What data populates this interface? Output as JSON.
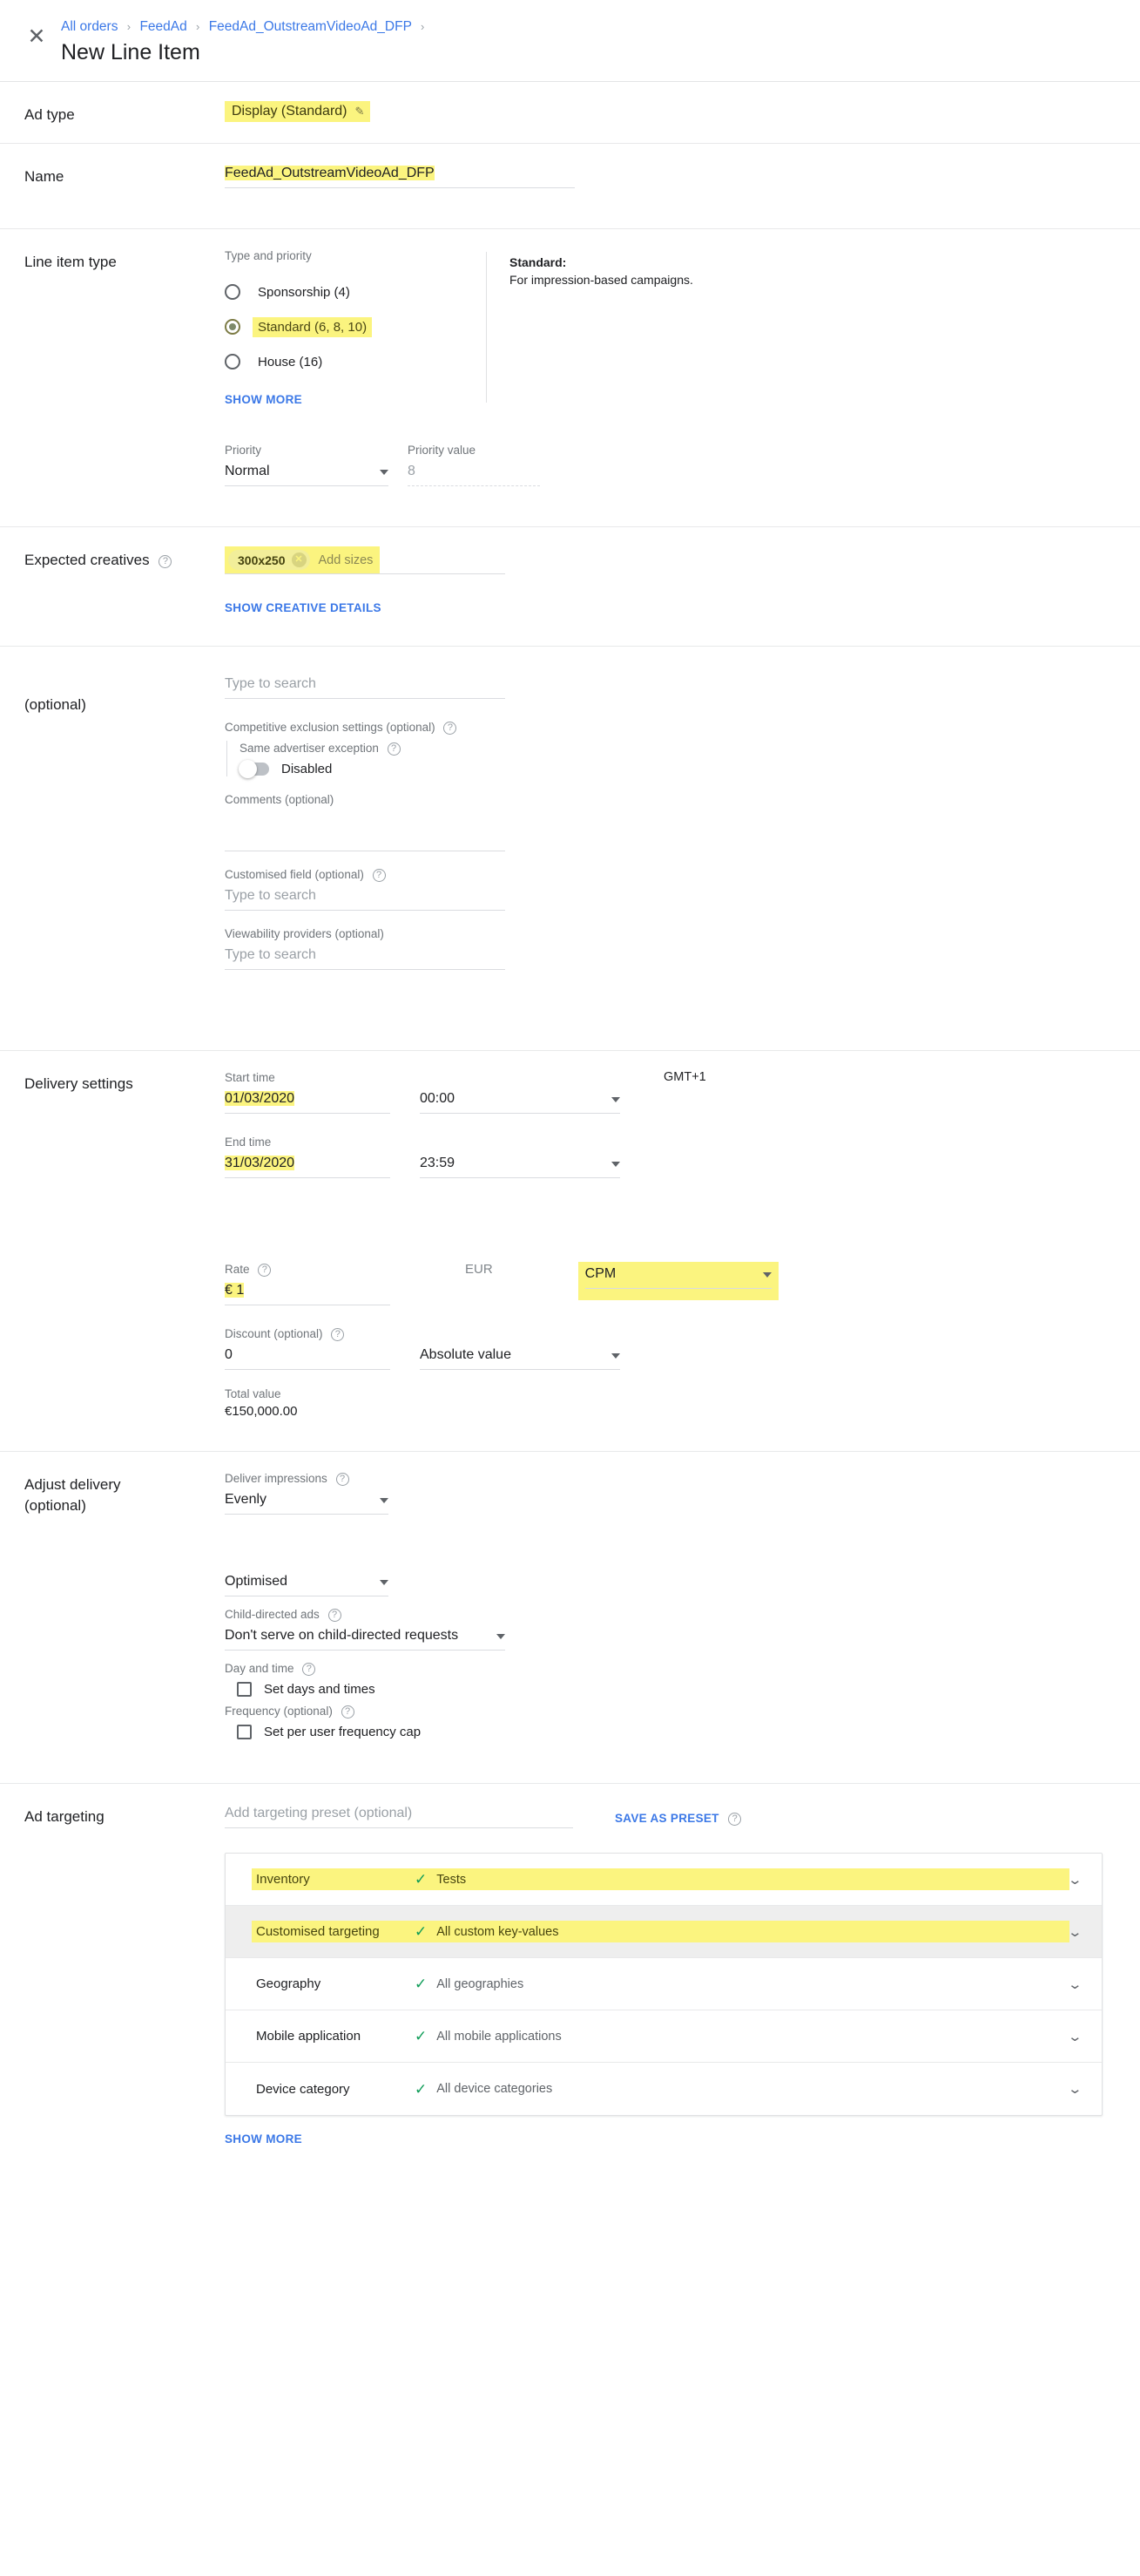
{
  "header": {
    "close_icon": "close-icon",
    "breadcrumb": [
      "All orders",
      "FeedAd",
      "FeedAd_OutstreamVideoAd_DFP"
    ],
    "separator": "›",
    "title": "New Line Item"
  },
  "ad_type": {
    "label": "Ad type",
    "value": "Display (Standard)",
    "edit_icon": "✎"
  },
  "name": {
    "label": "Name",
    "value": "FeedAd_OutstreamVideoAd_DFP"
  },
  "line_item_type": {
    "label": "Line item type",
    "group_label": "Type and priority",
    "options": [
      {
        "label": "Sponsorship (4)",
        "selected": false
      },
      {
        "label": "Standard (6, 8, 10)",
        "selected": true
      },
      {
        "label": "House (16)",
        "selected": false
      }
    ],
    "show_more": "SHOW MORE",
    "info_title": "Standard:",
    "info_body": "For impression-based campaigns.",
    "priority_label": "Priority",
    "priority_value": "Normal",
    "priority_value_label": "Priority value",
    "priority_value_number": "8"
  },
  "expected_creatives": {
    "label": "Expected creatives",
    "size_chip": "300x250",
    "chip_remove": "✕",
    "add_sizes_placeholder": "Add sizes",
    "show_creative_details": "SHOW CREATIVE DETAILS"
  },
  "optional_section": {
    "label": "(optional)",
    "search_placeholder": "Type to search",
    "competitive_exclusion_label": "Competitive exclusion settings (optional)",
    "same_advertiser_label": "Same advertiser exception",
    "toggle_state": "Disabled",
    "comments_label": "Comments (optional)",
    "comments_value": "",
    "customised_field_label": "Customised field (optional)",
    "customised_field_placeholder": "Type to search",
    "viewability_label": "Viewability providers (optional)",
    "viewability_placeholder": "Type to search"
  },
  "delivery": {
    "label": "Delivery settings",
    "start_time_label": "Start time",
    "start_date": "01/03/2020",
    "start_clock": "00:00",
    "timezone": "GMT+1",
    "end_time_label": "End time",
    "end_date": "31/03/2020",
    "end_clock": "23:59",
    "rate_label": "Rate",
    "rate_value": "€ 1",
    "currency": "EUR",
    "rate_type": "CPM",
    "discount_label": "Discount (optional)",
    "discount_value": "0",
    "discount_type": "Absolute value",
    "total_label": "Total value",
    "total_value": "€150,000.00"
  },
  "adjust_delivery": {
    "label_line1": "Adjust delivery",
    "label_line2": "(optional)",
    "deliver_impressions_label": "Deliver impressions",
    "deliver_impressions_value": "Evenly",
    "rotate_creatives_value": "Optimised",
    "child_directed_label": "Child-directed ads",
    "child_directed_value": "Don't serve on child-directed requests",
    "day_time_label": "Day and time",
    "set_days_times": "Set days and times",
    "frequency_label": "Frequency (optional)",
    "set_frequency_cap": "Set per user frequency cap"
  },
  "ad_targeting": {
    "label": "Ad targeting",
    "preset_placeholder": "Add targeting preset (optional)",
    "save_as_preset": "SAVE AS PRESET",
    "rows": [
      {
        "name": "Inventory",
        "value": "Tests",
        "highlight": true,
        "alt": false
      },
      {
        "name": "Customised targeting",
        "value": "All custom key-values",
        "highlight": true,
        "alt": true
      },
      {
        "name": "Geography",
        "value": "All geographies",
        "highlight": false,
        "alt": false
      },
      {
        "name": "Mobile application",
        "value": "All mobile applications",
        "highlight": false,
        "alt": false
      },
      {
        "name": "Device category",
        "value": "All device categories",
        "highlight": false,
        "alt": false
      }
    ],
    "tick_icon": "✓",
    "chevron_icon": "⌄",
    "show_more": "SHOW MORE"
  },
  "colors": {
    "highlight": "#fbf47f",
    "link": "#3b78e7",
    "tick_green": "#0f9d58"
  }
}
